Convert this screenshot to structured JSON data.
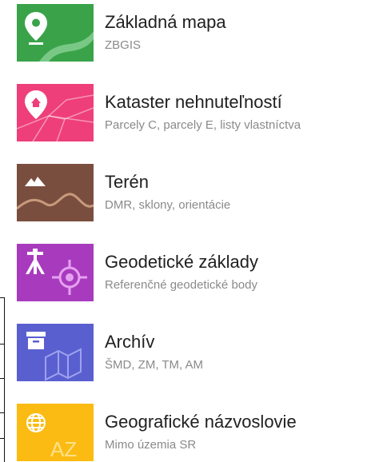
{
  "layers": [
    {
      "title": "Základná mapa",
      "subtitle": "ZBGIS",
      "icon": "map-pin-road-icon",
      "color": "#3aa34a"
    },
    {
      "title": "Kataster nehnuteľností",
      "subtitle": "Parcely C, parcely E, listy vlastníctva",
      "icon": "home-pin-parcels-icon",
      "color": "#ee3f7a"
    },
    {
      "title": "Terén",
      "subtitle": "DMR, sklony, orientácie",
      "icon": "mountain-terrain-icon",
      "color": "#7a4e3e"
    },
    {
      "title": "Geodetické základy",
      "subtitle": "Referenčné geodetické body",
      "icon": "survey-tripod-target-icon",
      "color": "#a83bbd"
    },
    {
      "title": "Archív",
      "subtitle": "ŠMD, ZM, TM, AM",
      "icon": "archive-box-map-icon",
      "color": "#5a5fd0"
    },
    {
      "title": "Geografické názvoslovie",
      "subtitle": "Mimo územia SR",
      "icon": "globe-az-icon",
      "color": "#fbbb12",
      "tile_text": "AZ"
    }
  ]
}
